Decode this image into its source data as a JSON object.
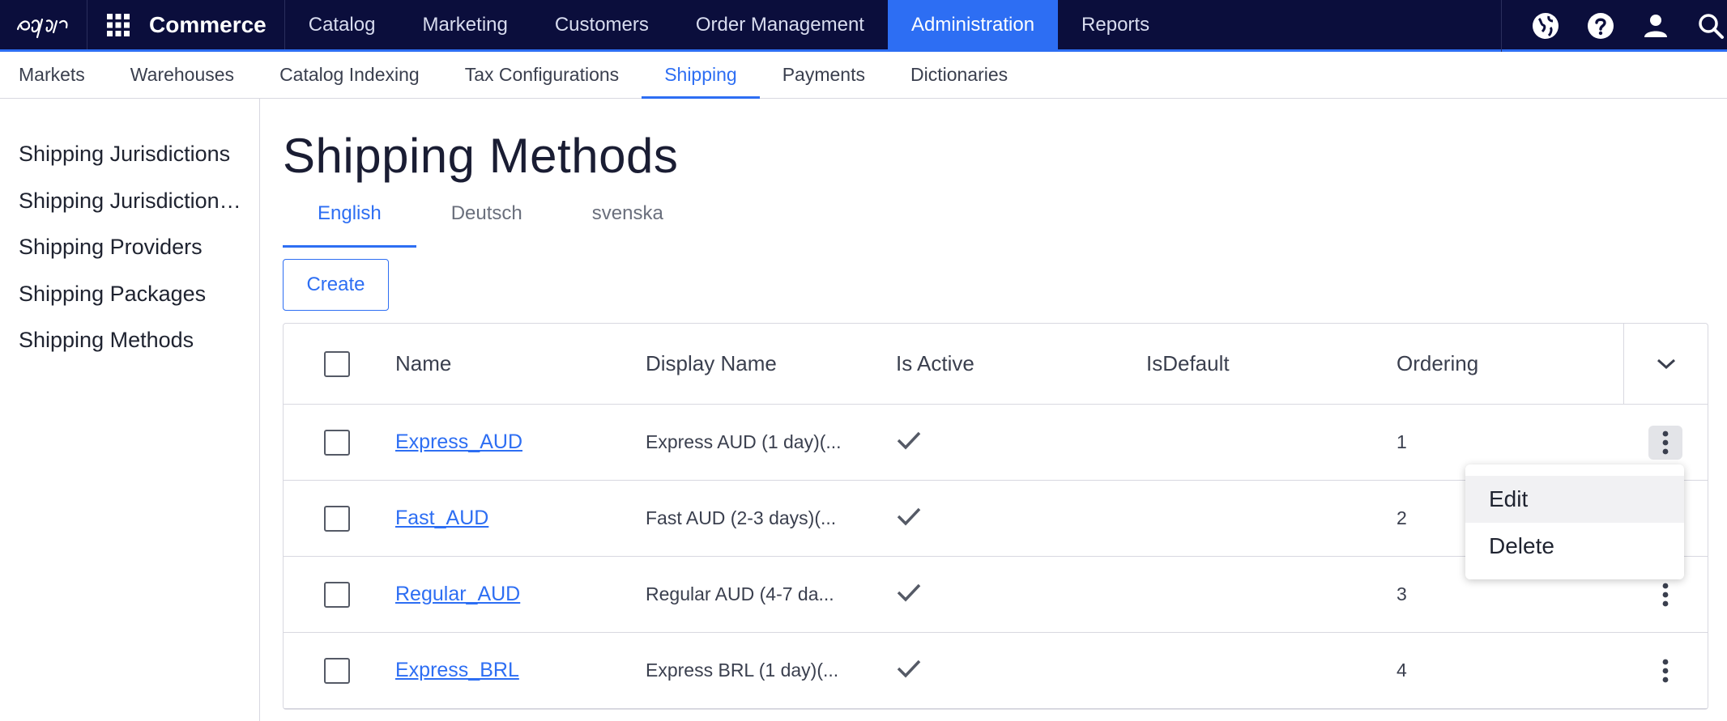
{
  "topnav": {
    "brand": "Commerce",
    "items": [
      {
        "label": "Catalog"
      },
      {
        "label": "Marketing"
      },
      {
        "label": "Customers"
      },
      {
        "label": "Order Management"
      },
      {
        "label": "Administration",
        "active": true
      },
      {
        "label": "Reports"
      }
    ],
    "icons": [
      "globe-icon",
      "help-icon",
      "user-icon",
      "search-icon"
    ]
  },
  "subnav": {
    "items": [
      {
        "label": "Markets"
      },
      {
        "label": "Warehouses"
      },
      {
        "label": "Catalog Indexing"
      },
      {
        "label": "Tax Configurations"
      },
      {
        "label": "Shipping",
        "active": true
      },
      {
        "label": "Payments"
      },
      {
        "label": "Dictionaries"
      }
    ]
  },
  "sidebar": {
    "items": [
      {
        "label": "Shipping Jurisdictions"
      },
      {
        "label": "Shipping Jurisdiction Groups"
      },
      {
        "label": "Shipping Providers"
      },
      {
        "label": "Shipping Packages"
      },
      {
        "label": "Shipping Methods"
      }
    ]
  },
  "main": {
    "title": "Shipping Methods",
    "languages": [
      {
        "label": "English",
        "active": true
      },
      {
        "label": "Deutsch"
      },
      {
        "label": "svenska"
      }
    ],
    "create_label": "Create",
    "grid": {
      "columns": {
        "name": "Name",
        "display_name": "Display Name",
        "is_active": "Is Active",
        "is_default": "IsDefault",
        "ordering": "Ordering"
      },
      "rows": [
        {
          "name": "Express_AUD",
          "display_name": "Express AUD (1 day)(...",
          "is_active": true,
          "ordering": "1"
        },
        {
          "name": "Fast_AUD",
          "display_name": "Fast AUD (2-3 days)(...",
          "is_active": true,
          "ordering": "2"
        },
        {
          "name": "Regular_AUD",
          "display_name": "Regular AUD (4-7 da...",
          "is_active": true,
          "ordering": "3"
        },
        {
          "name": "Express_BRL",
          "display_name": "Express BRL (1 day)(...",
          "is_active": true,
          "ordering": "4"
        }
      ]
    },
    "context_menu": {
      "items": [
        {
          "label": "Edit"
        },
        {
          "label": "Delete"
        }
      ]
    }
  },
  "colors": {
    "topnav_bg": "#0b0e3c",
    "accent": "#2d6ef3"
  }
}
